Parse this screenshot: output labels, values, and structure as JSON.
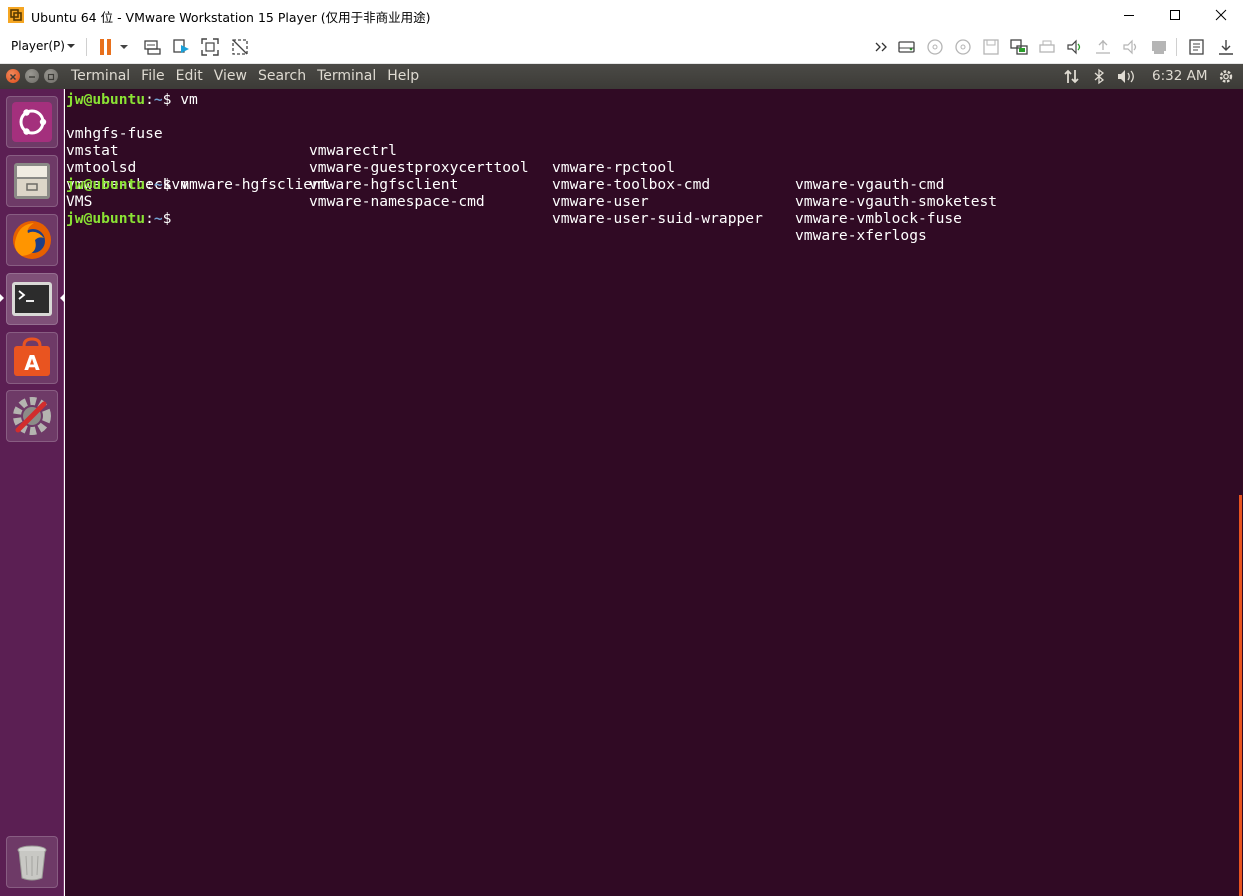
{
  "window": {
    "title": "Ubuntu 64 位 - VMware Workstation 15 Player (仅用于非商业用途)",
    "controls": [
      "minimize",
      "maximize",
      "close"
    ]
  },
  "vmware_toolbar": {
    "player_menu": "Player(P)",
    "accent": "#e8701c"
  },
  "ubuntu_panel": {
    "menus": [
      "Terminal",
      "File",
      "Edit",
      "View",
      "Search",
      "Terminal",
      "Help"
    ],
    "clock": "6:32 AM"
  },
  "launcher": {
    "apps": [
      "ubuntu-dash-icon",
      "files-icon",
      "firefox-icon",
      "terminal-icon",
      "software-center-icon",
      "system-settings-icon"
    ],
    "trash": "trash-icon"
  },
  "terminal": {
    "prompt_user": "jw@ubuntu",
    "prompt_path": "~",
    "prompt_symbol": "$",
    "cmd1": " vm",
    "completions": [
      [
        "vmhgfs-fuse",
        "vmwarectrl",
        "vmware-rpctool",
        "vmware-vgauth-cmd"
      ],
      [
        "vmstat",
        "vmware-guestproxycerttool",
        "vmware-toolbox-cmd",
        "vmware-vgauth-smoketest"
      ],
      [
        "vmtoolsd",
        "vmware-hgfsclient",
        "vmware-user",
        "vmware-vmblock-fuse"
      ],
      [
        "vmware-checkvm",
        "vmware-namespace-cmd",
        "vmware-user-suid-wrapper",
        "vmware-xferlogs"
      ]
    ],
    "cmd2": " vmware-hgfsclient",
    "output": "VMS",
    "colors": {
      "background": "#300a24",
      "user": "#8ae234",
      "path": "#729fcf",
      "text": "#ffffff"
    }
  }
}
